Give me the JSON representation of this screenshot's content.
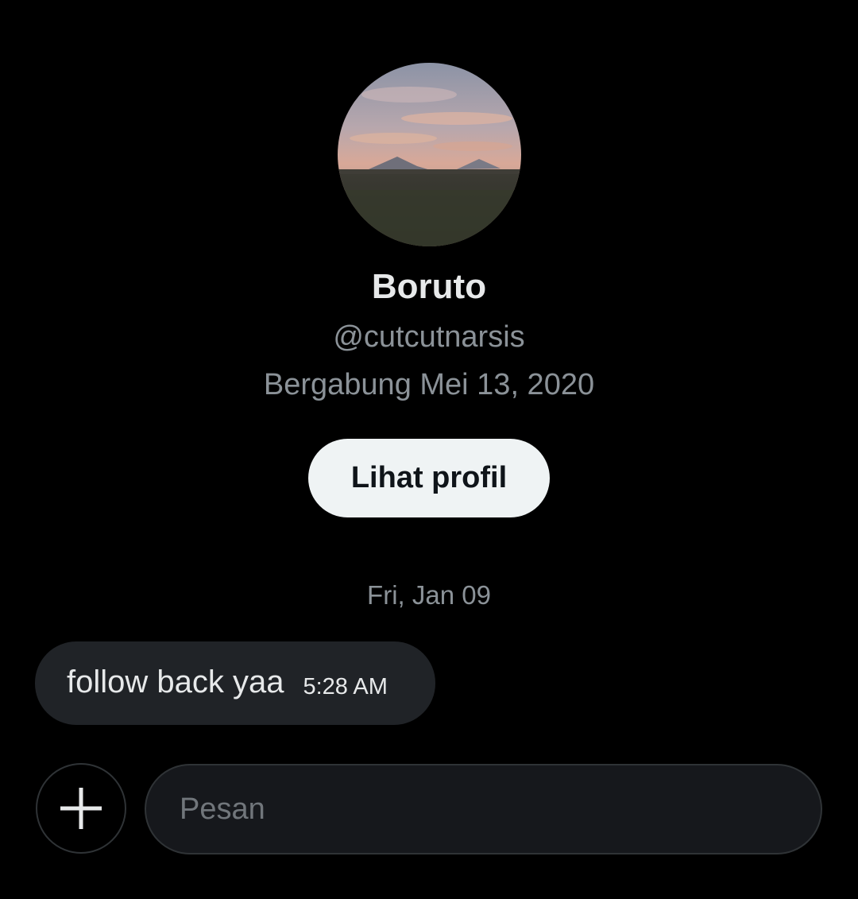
{
  "profile": {
    "display_name": "Boruto",
    "handle": "@cutcutnarsis",
    "joined": "Bergabung Mei 13, 2020",
    "view_profile_label": "Lihat profil",
    "avatar_icon": "landscape-photo"
  },
  "conversation": {
    "date_divider": "Fri, Jan 09",
    "messages": [
      {
        "text": "follow back yaa",
        "time": "5:28 AM",
        "direction": "incoming"
      }
    ]
  },
  "composer": {
    "placeholder": "Pesan",
    "value": "",
    "add_icon": "plus-icon"
  },
  "colors": {
    "background": "#000000",
    "primary_text": "#e7e9ea",
    "secondary_text": "#8b9298",
    "bubble": "#202327",
    "button_bg": "#eff3f4",
    "border": "#2f3336"
  }
}
